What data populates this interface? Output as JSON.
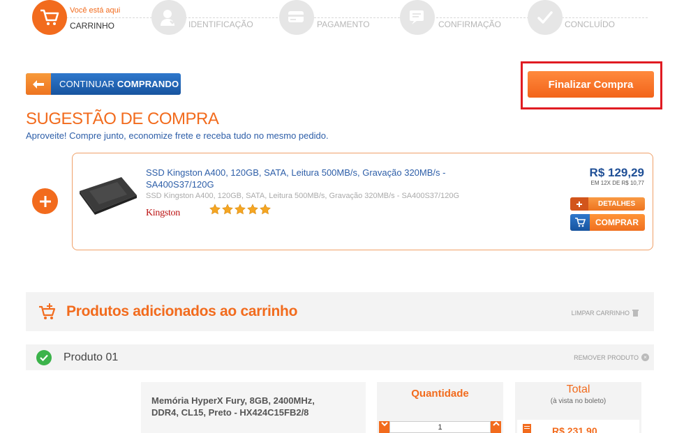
{
  "steps": {
    "current_hint": "Você está aqui",
    "items": [
      {
        "label": "CARRINHO"
      },
      {
        "label": "IDENTIFICAÇÃO"
      },
      {
        "label": "PAGAMENTO"
      },
      {
        "label": "CONFIRMAÇÃO"
      },
      {
        "label": "CONCLUÍDO"
      }
    ]
  },
  "actions": {
    "continue_prefix": "CONTINUAR",
    "continue_bold": "COMPRANDO",
    "finalizar": "Finalizar Compra"
  },
  "suggestion": {
    "title": "SUGESTÃO DE COMPRA",
    "subtitle": "Aproveite! Compre junto, economize frete e receba tudo no mesmo pedido.",
    "product": {
      "name": "SSD Kingston A400, 120GB, SATA, Leitura 500MB/s, Gravação 320MB/s - SA400S37/120G",
      "description": "SSD Kingston A400, 120GB, SATA, Leitura 500MB/s, Gravação 320MB/s - SA400S37/120G",
      "brand": "Kingston",
      "rating": 5,
      "price": "R$ 129,29",
      "installments": "EM 12X DE R$ 10,77",
      "details_label": "DETALHES",
      "buy_label": "COMPRAR"
    }
  },
  "cart": {
    "title": "Produtos adicionados ao carrinho",
    "clear_label": "LIMPAR CARRINHO",
    "product_label": "Produto 01",
    "remove_label": "REMOVER PRODUTO",
    "item_name": "Memória HyperX Fury, 8GB, 2400MHz, DDR4, CL15, Preto - HX424C15FB2/8",
    "quantity_title": "Quantidade",
    "quantity_value": "1",
    "total_title": "Total",
    "total_sub": "(à vista no boleto)",
    "total_price": "R$ 231,90"
  },
  "colors": {
    "accent": "#f26b1d",
    "blue": "#2d5ea8",
    "highlight": "#e01b22"
  }
}
